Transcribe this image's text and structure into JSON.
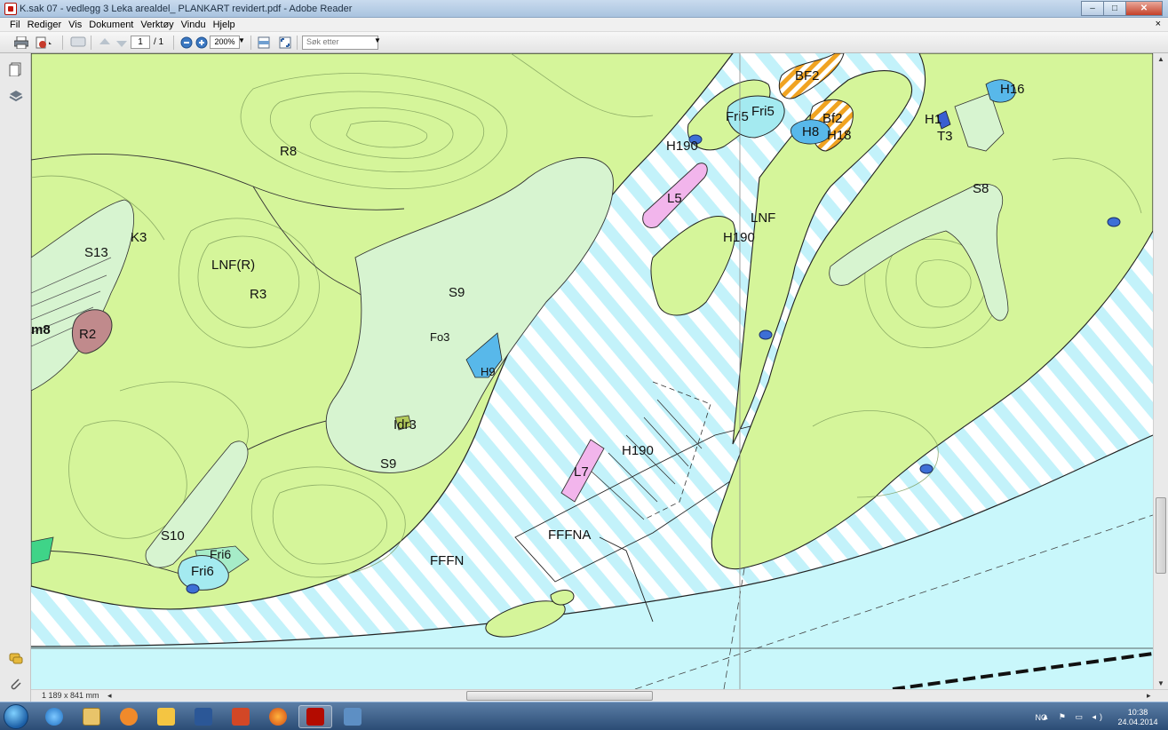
{
  "window": {
    "title": "K.sak 07 - vedlegg 3 Leka arealdel_ PLANKART revidert.pdf - Adobe Reader",
    "minimize_label": "–",
    "maximize_label": "□",
    "close_label": "✕"
  },
  "menu": {
    "items": [
      "Fil",
      "Rediger",
      "Vis",
      "Dokument",
      "Verktøy",
      "Vindu",
      "Hjelp"
    ],
    "doc_close": "×"
  },
  "toolbar": {
    "page_current": "1",
    "page_total": "/ 1",
    "zoom": "200%",
    "search_placeholder": "Søk etter"
  },
  "map": {
    "labels": [
      "LNF(R)",
      "S13",
      "K3",
      "R3",
      "R2",
      "R8",
      "m8",
      "S9",
      "Fo3",
      "H9",
      "Idr3",
      "S9",
      "S10",
      "Fri6",
      "Fri6",
      "FFFN",
      "FFFNA",
      "H190",
      "L7",
      "L5",
      "H190",
      "LNF",
      "H190",
      "Fri5",
      "Fri5",
      "BF2",
      "Bf2",
      "H8",
      "H18",
      "H16",
      "H1",
      "T3",
      "S8"
    ]
  },
  "statusbar": {
    "page_size": "1 189 x 841 mm"
  },
  "taskbar": {
    "language": "NO",
    "time": "10:38",
    "date": "24.04.2014"
  }
}
